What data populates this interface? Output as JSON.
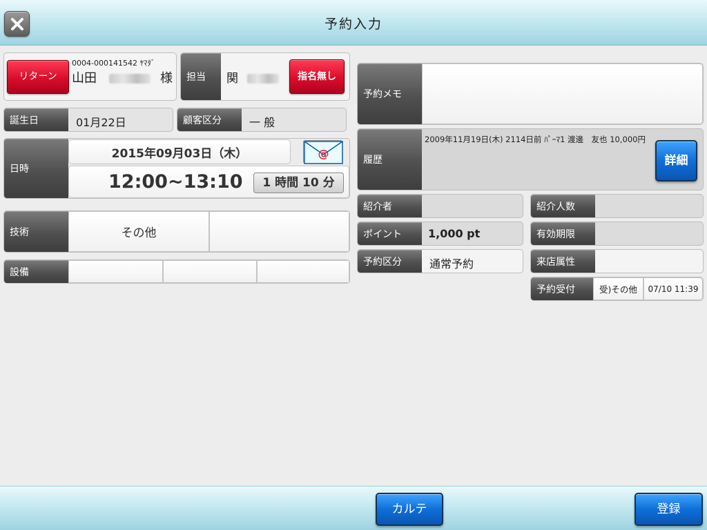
{
  "header": {
    "title": "予約入力"
  },
  "customer": {
    "return_label": "リターン",
    "code": "0004-000141542 ﾔﾏﾀﾞ",
    "name": "山田",
    "honorific": "様"
  },
  "staff": {
    "label": "担当",
    "name": "関",
    "no_nominate_label": "指名無し"
  },
  "birthday": {
    "label": "誕生日",
    "value": "01月22日"
  },
  "customer_class": {
    "label": "顧客区分",
    "value": "一 般"
  },
  "datetime": {
    "label": "日時",
    "date": "2015年09月03日（木）",
    "time": "12:00~13:10",
    "duration": "1 時間 10 分"
  },
  "technique": {
    "label": "技術",
    "value1": "その他",
    "value2": ""
  },
  "equipment": {
    "label": "設備"
  },
  "memo": {
    "label": "予約メモ",
    "value": ""
  },
  "history": {
    "label": "履歴",
    "text": "2009年11月19日(木) 2114日前 ﾊﾟｰﾏ1 渡邊　友也 10,000円",
    "detail_label": "詳細"
  },
  "referrer": {
    "label": "紹介者",
    "value": ""
  },
  "referral_count": {
    "label": "紹介人数",
    "value": ""
  },
  "points": {
    "label": "ポイント",
    "value": "1,000 pt"
  },
  "expiry": {
    "label": "有効期限",
    "value": ""
  },
  "reservation_type": {
    "label": "予約区分",
    "value": "通常予約"
  },
  "visit_attr": {
    "label": "来店属性",
    "value": ""
  },
  "reception": {
    "label": "予約受付",
    "channel": "受)その他",
    "datetime": "07/10 11:39"
  },
  "footer": {
    "karte_label": "カルテ",
    "register_label": "登録"
  }
}
